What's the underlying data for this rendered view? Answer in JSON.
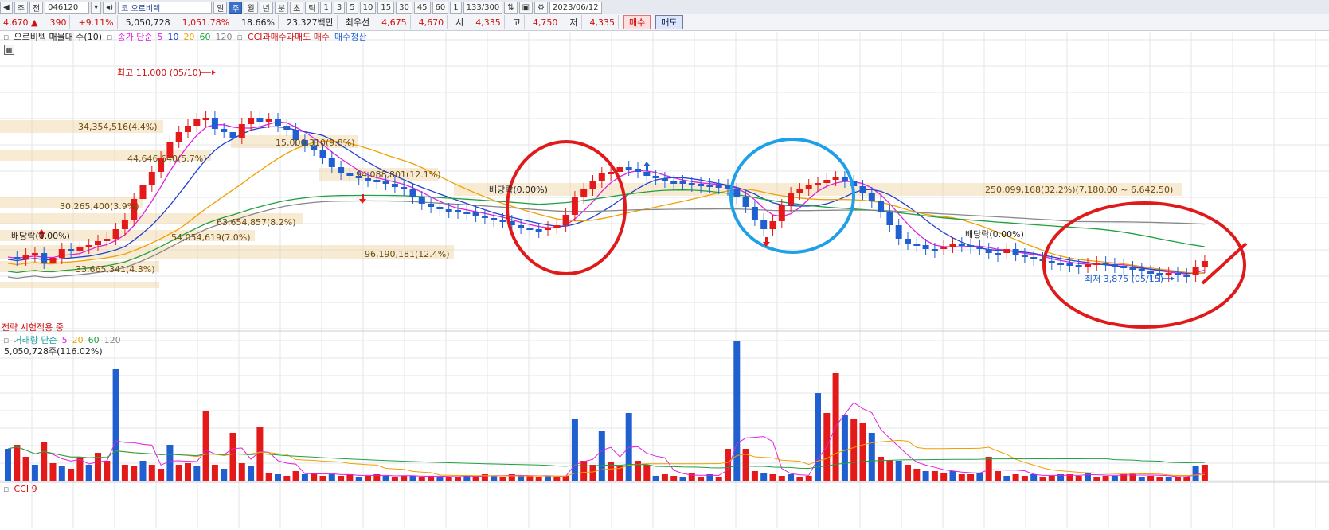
{
  "toolbar": {
    "mode": "주",
    "market": "전",
    "code": "046120",
    "stock_prefix": "코",
    "stock_name": "오르비텍",
    "periods": [
      "일",
      "주",
      "월",
      "년",
      "분",
      "초",
      "틱"
    ],
    "active_period": "주",
    "intervals": [
      "1",
      "3",
      "5",
      "10",
      "15",
      "30",
      "45",
      "60"
    ],
    "unit": "1",
    "count": "133/300",
    "date": "2023/06/12"
  },
  "price_bar": {
    "price": "4,670",
    "arrow": "▲",
    "change": "390",
    "change_pct": "+9.11%",
    "volume": "5,050,728",
    "volume_ratio": "1,051.78%",
    "turnover": "18.66%",
    "amount": "23,327백만",
    "best_bid_label": "최우선",
    "best_ask": "4,675",
    "best_bid": "4,670",
    "open_label": "시",
    "open": "4,335",
    "high_label": "고",
    "high": "4,750",
    "low_label": "저",
    "low": "4,335",
    "buy_label": "매수",
    "sell_label": "매도"
  },
  "price_legend": {
    "title": "오르비텍 매물대 수(10)",
    "ma_label": "종가 단순",
    "ma_periods": [
      "5",
      "10",
      "20",
      "60",
      "120"
    ],
    "signal_label": "CCI과매수과매도 매수",
    "signal_exit": "매수청산"
  },
  "annotations": {
    "high": "최고 11,000 (05/10)",
    "low": "최저 3,875 (05/15)",
    "dividend_1": "배당락(0.00%)",
    "dividend_2": "배당락(0.00%)",
    "dividend_3": "배당락(0.00%)",
    "strategy": "전략 시험적용 중"
  },
  "profile_labels": [
    "34,354,516(4.4%)",
    "44,646,640(5.7%)",
    "30,265,400(3.9%)",
    "63,654,857(8.2%)",
    "54,054,619(7.0%)",
    "33,665,341(4.3%)",
    "15,000,310(9.8%)",
    "94,088,801(12.1%)",
    "96,190,181(12.4%)",
    "250,099,168(32.2%)(7,180.00 ~ 6,642.50)"
  ],
  "volume_legend": {
    "title": "거래량 단순",
    "ma_periods": [
      "5",
      "20",
      "60",
      "120"
    ],
    "value": "5,050,728주(116.02%)"
  },
  "cci_legend": {
    "title": "CCI 9"
  },
  "colors": {
    "up": "#e41a1a",
    "down": "#1f5fd0",
    "ma5": "#e020e0",
    "ma10": "#2040d0",
    "ma20": "#f0a000",
    "ma60": "#20a040",
    "ma120": "#888888",
    "circle_red": "#e01a1a",
    "circle_blue": "#1ea0e8"
  }
}
